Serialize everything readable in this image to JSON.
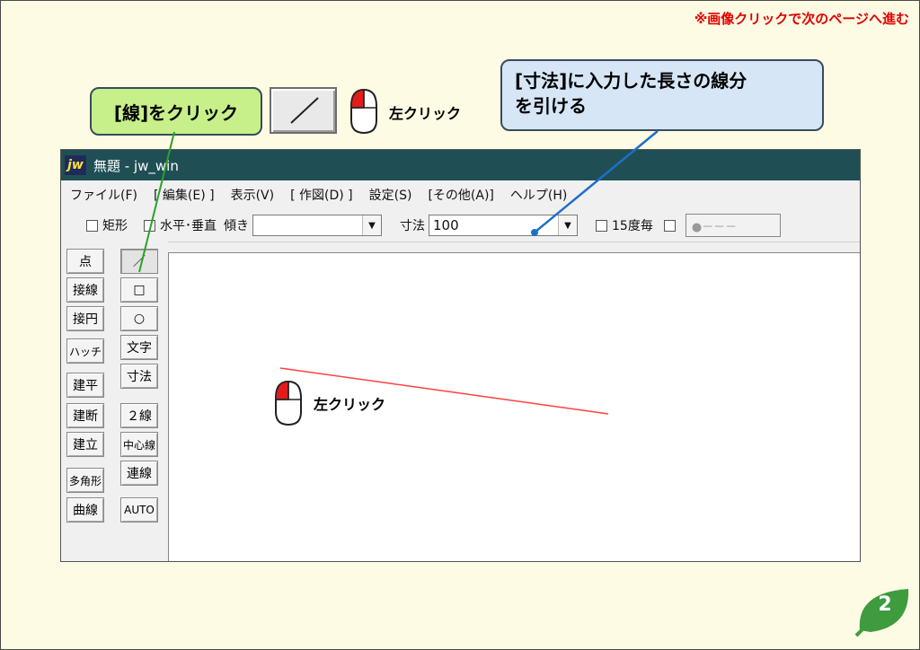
{
  "top_note": "※画像クリックで次のページへ進む",
  "callout_left": {
    "text": "[線]をクリック"
  },
  "callout_right": {
    "line1": "[寸法]に入力した長さの線分",
    "line2": "を引ける"
  },
  "mouse_labels": {
    "top": "左クリック",
    "canvas": "左クリック"
  },
  "window": {
    "logo": "jw",
    "title": "無題 - jw_win",
    "menu": [
      "ファイル(F)",
      "[ 編集(E) ]",
      "表示(V)",
      "[ 作図(D) ]",
      "設定(S)",
      "[その他(A)]",
      "ヘルプ(H)"
    ],
    "toolbar": {
      "rect_label": "矩形",
      "hv_label": "水平･垂直",
      "tilt_label": "傾き",
      "tilt_value": "",
      "dim_label": "寸法",
      "dim_value": "100",
      "deg_label": "15度毎",
      "lamp_text": "●－－－"
    },
    "left_tools": [
      "点",
      "接線",
      "接円",
      "ハッチ",
      "建平",
      "建断",
      "建立",
      "多角形",
      "曲線"
    ],
    "right_tools": [
      "／",
      "□",
      "○",
      "文字",
      "寸法",
      "２線",
      "中心線",
      "連線",
      "AUTO"
    ]
  },
  "page_number": "2",
  "colors": {
    "drawn_line": "#ff4040",
    "arrow": "#1e6fc7",
    "pointer": "#2aa02a",
    "titlebar": "#1f4f55"
  }
}
